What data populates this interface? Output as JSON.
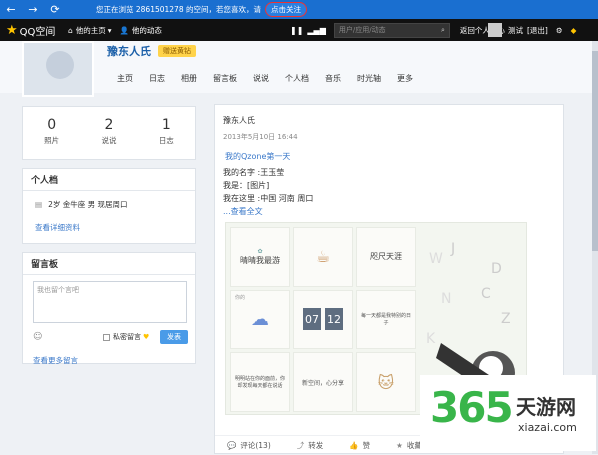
{
  "topbar": {
    "notice": "您正在浏览 2861501278 的空间，若您喜欢，请",
    "notice_btn": "点击关注"
  },
  "navbar": {
    "logo": "QQ空间",
    "home": "他的主页",
    "feed": "他的动态",
    "search_placeholder": "用户/应用/动态",
    "back": "返回个人中心",
    "user": "测试",
    "logout": "[退出]"
  },
  "profile": {
    "name": "豫东人氏",
    "badge": "赠送黄钻"
  },
  "tabs": [
    "主页",
    "日志",
    "相册",
    "留言板",
    "说说",
    "个人档",
    "音乐",
    "时光轴",
    "更多"
  ],
  "stats": [
    {
      "num": "0",
      "label": "照片"
    },
    {
      "num": "2",
      "label": "说说"
    },
    {
      "num": "1",
      "label": "日志"
    }
  ],
  "profile_card": {
    "title": "个人档",
    "info": "2岁  金牛座 男 现居周口",
    "link": "查看详细资料"
  },
  "message_board": {
    "title": "留言板",
    "placeholder": "我也留个言吧",
    "private": "私密留言",
    "send": "发表",
    "more": "查看更多留言"
  },
  "post": {
    "author": "豫东人氏",
    "date": "2013年5月10日 16:44",
    "title": "我的Qzone第一天",
    "lines": [
      "我的名字 :王玉莹",
      "我是：[图片]",
      "我在这里 :中国 河南 周口"
    ],
    "more": "...查看全文",
    "grid": {
      "c1": "晴晴我最游",
      "c3": "咫尺天涯",
      "c5_label": "你的",
      "clock_h": "07",
      "clock_m": "12",
      "c6": "每一天都是我特别的日子",
      "c7": "明明站在你的面前，你却发现每天都在说话",
      "c8": "新空间，心分享"
    }
  },
  "footer": {
    "comment": "评论(13)",
    "forward": "转发",
    "like": "赞",
    "fav": "收藏"
  },
  "watermark": {
    "num": "365",
    "cn": "天游网",
    "url": "xiazai.com"
  }
}
